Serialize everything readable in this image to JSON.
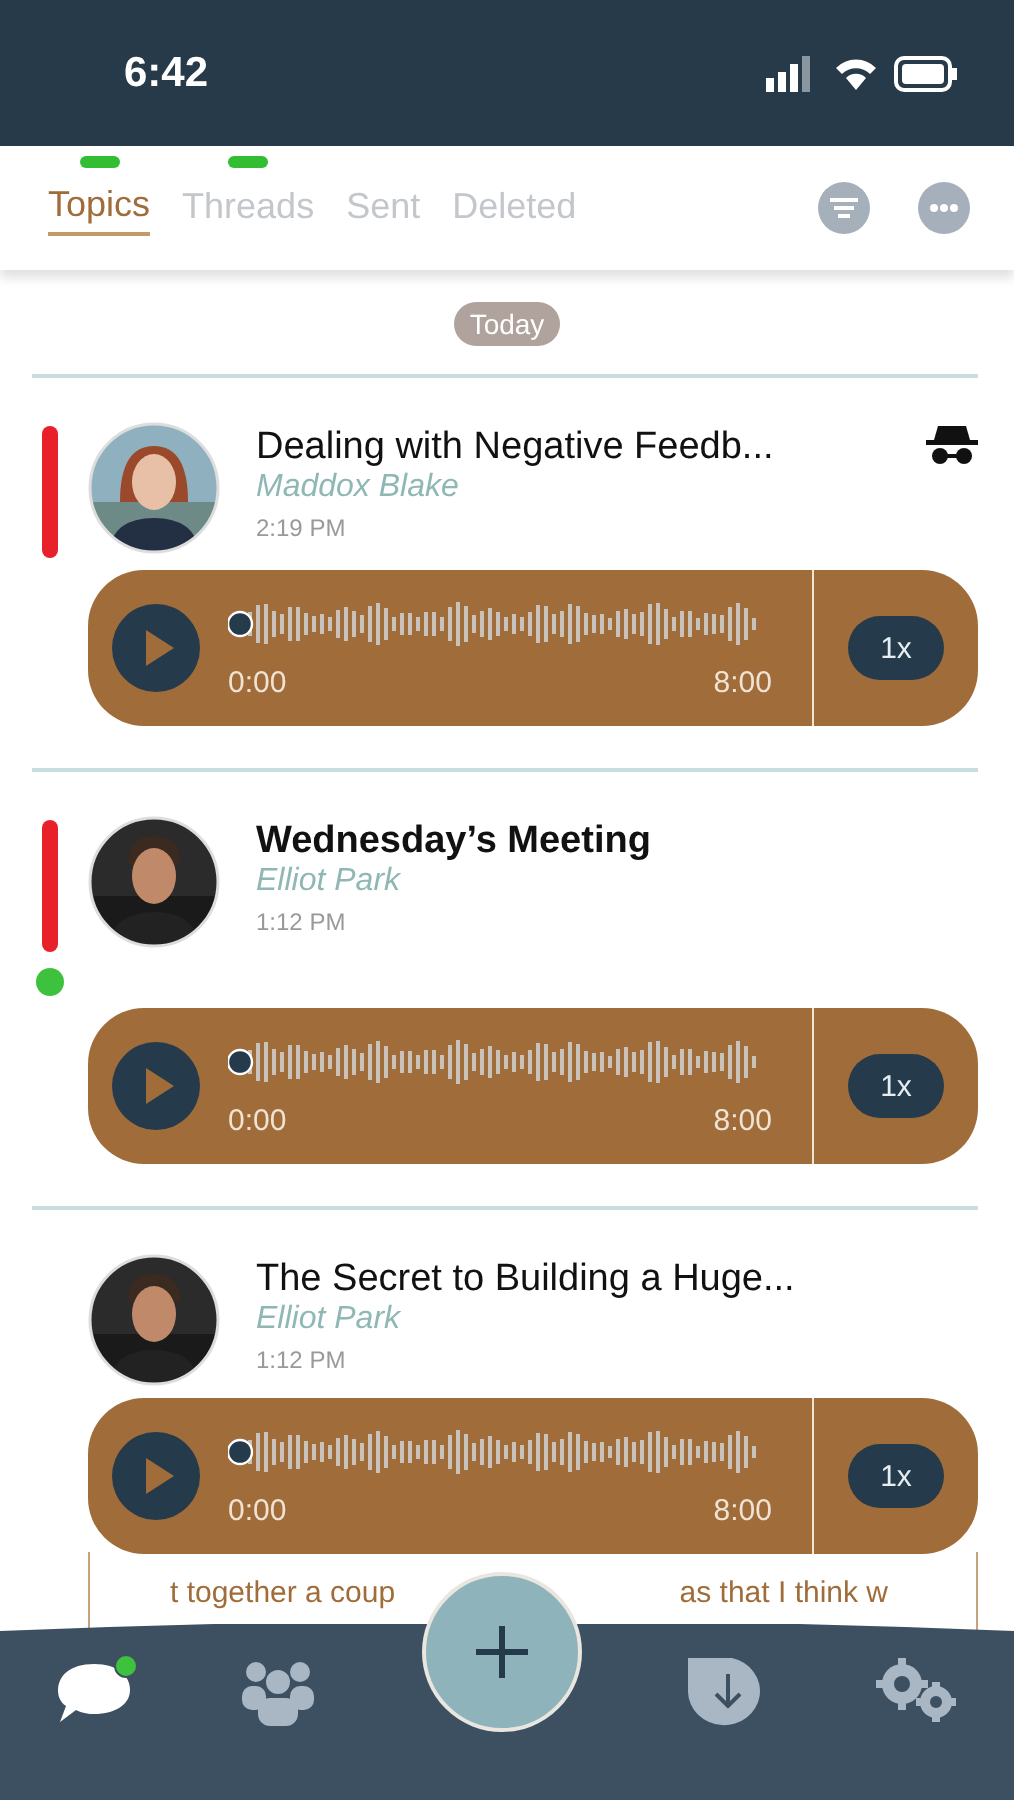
{
  "status_bar": {
    "time": "6:42"
  },
  "tabs": [
    {
      "label": "Topics",
      "selected": true,
      "badge": true
    },
    {
      "label": "Threads",
      "selected": false,
      "badge": true
    },
    {
      "label": "Sent",
      "selected": false,
      "badge": false
    },
    {
      "label": "Deleted",
      "selected": false,
      "badge": false
    }
  ],
  "date_label": "Today",
  "messages": [
    {
      "title": "Dealing with Negative Feedb...",
      "author": "Maddox Blake",
      "time": "2:19 PM",
      "flagged": true,
      "online": false,
      "unread": false,
      "anonymous": true,
      "player": {
        "start": "0:00",
        "end": "8:00",
        "speed": "1x"
      }
    },
    {
      "title": "Wednesday’s Meeting",
      "author": "Elliot Park",
      "time": "1:12 PM",
      "flagged": true,
      "online": true,
      "unread": true,
      "anonymous": false,
      "player": {
        "start": "0:00",
        "end": "8:00",
        "speed": "1x"
      }
    },
    {
      "title": "The Secret to Building a Huge...",
      "author": "Elliot Park",
      "time": "1:12 PM",
      "flagged": false,
      "online": false,
      "unread": false,
      "anonymous": false,
      "player": {
        "start": "0:00",
        "end": "8:00",
        "speed": "1x"
      }
    }
  ],
  "preview": {
    "before": "t together a coup",
    "after": "as that I think w"
  },
  "nav": [
    {
      "kind": "chat",
      "selected": true,
      "badge": true
    },
    {
      "kind": "group",
      "selected": false
    },
    {
      "kind": "add",
      "selected": false
    },
    {
      "kind": "download",
      "selected": false
    },
    {
      "kind": "settings",
      "selected": false
    }
  ]
}
